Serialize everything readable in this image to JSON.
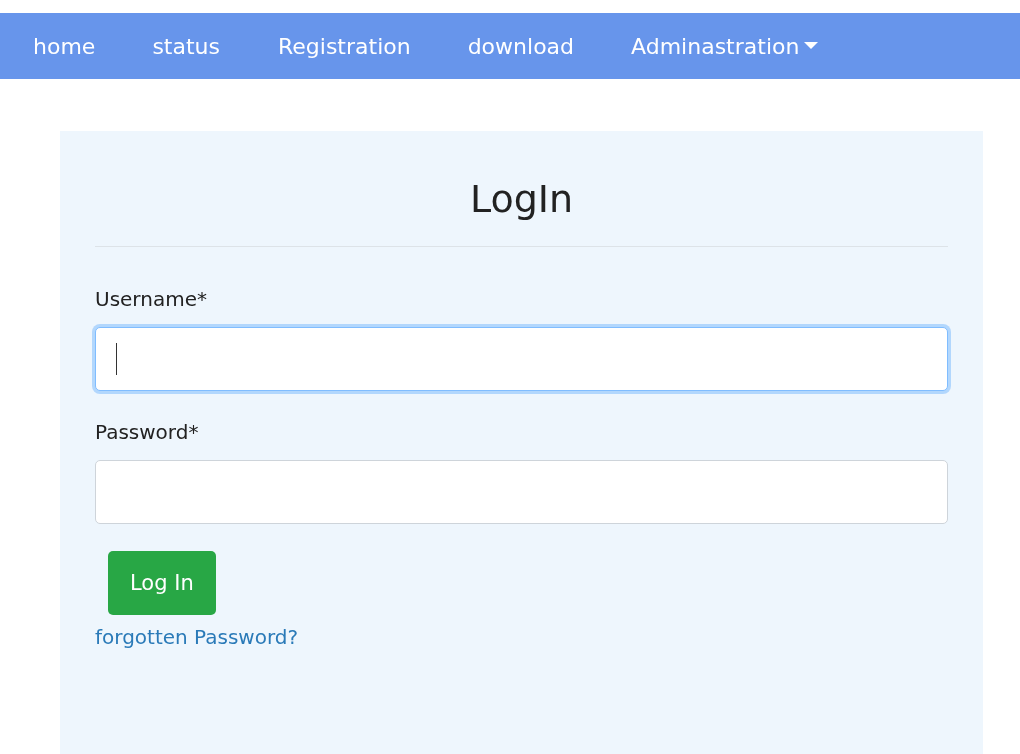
{
  "nav": {
    "items": [
      {
        "label": "home",
        "dropdown": false
      },
      {
        "label": "status",
        "dropdown": false
      },
      {
        "label": "Registration",
        "dropdown": false
      },
      {
        "label": "download",
        "dropdown": false
      },
      {
        "label": "Adminastration",
        "dropdown": true
      }
    ]
  },
  "form": {
    "title": "LogIn",
    "fields": [
      {
        "label": "Username*",
        "focused": true
      },
      {
        "label": "Password*",
        "focused": false
      }
    ],
    "button": "Log In",
    "link": "forgotten Password?"
  }
}
